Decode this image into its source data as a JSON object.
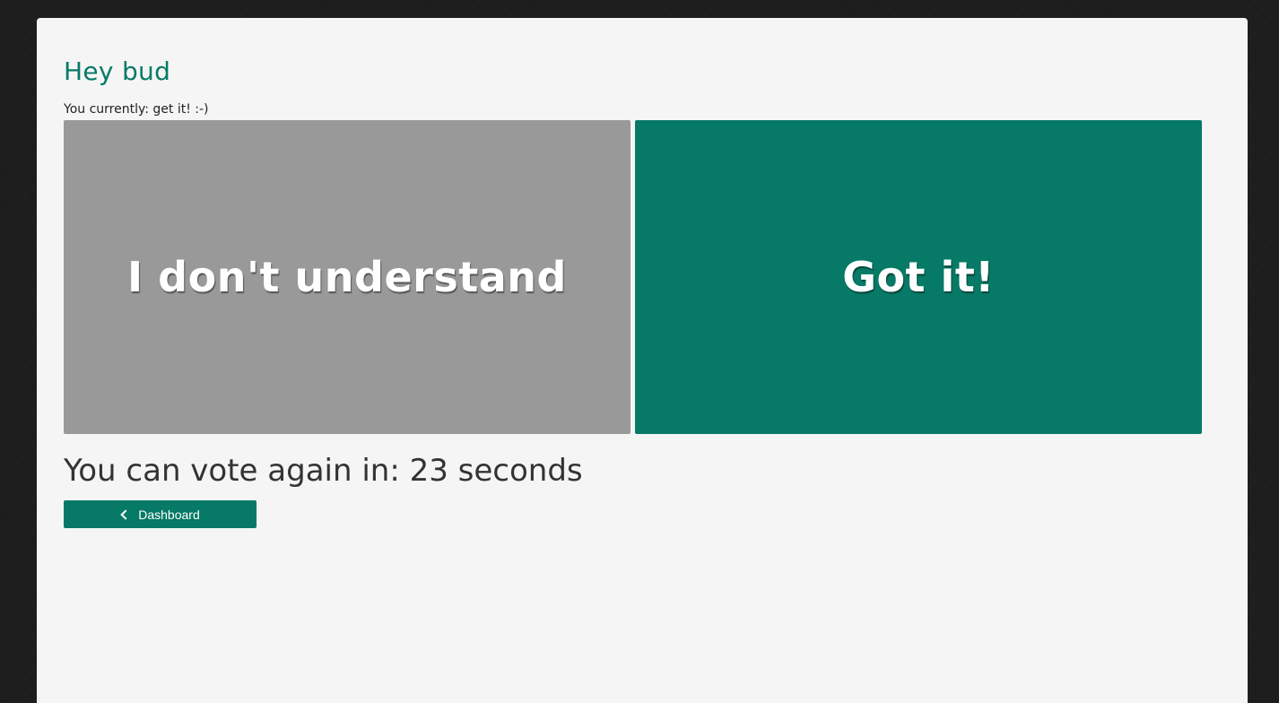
{
  "header": {
    "greeting": "Hey bud",
    "status": "You currently: get it! :-)"
  },
  "vote": {
    "confused_label": "I don't understand",
    "got_it_label": "Got it!"
  },
  "countdown": {
    "text": "You can vote again in: 23 seconds"
  },
  "nav": {
    "dashboard_label": "Dashboard",
    "dashboard_icon": "chevron-left-icon"
  },
  "colors": {
    "accent": "#067a66",
    "neutral_button": "#999999",
    "panel_background": "#f5f5f5",
    "page_background": "#1e1e1e"
  }
}
